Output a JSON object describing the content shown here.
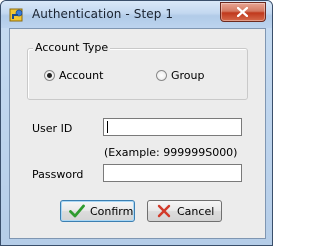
{
  "window": {
    "title": "Authentication - Step 1",
    "app_icon": "key-app-icon",
    "close_icon": "close-icon"
  },
  "account_type": {
    "legend": "Account Type",
    "options": [
      {
        "label": "Account",
        "checked": true
      },
      {
        "label": "Group",
        "checked": false
      }
    ]
  },
  "form": {
    "user_id_label": "User ID",
    "user_id_value": "",
    "example_hint": "(Example: 999999S000)",
    "password_label": "Password",
    "password_value": ""
  },
  "buttons": {
    "confirm_label": "Confirm",
    "confirm_icon": "checkmark-icon",
    "confirm_icon_color": "#2e9b2e",
    "cancel_label": "Cancel",
    "cancel_icon": "x-icon",
    "cancel_icon_color": "#d23a2a"
  },
  "colors": {
    "close_button": "#c0391d",
    "dialog_background": "#ececec"
  }
}
